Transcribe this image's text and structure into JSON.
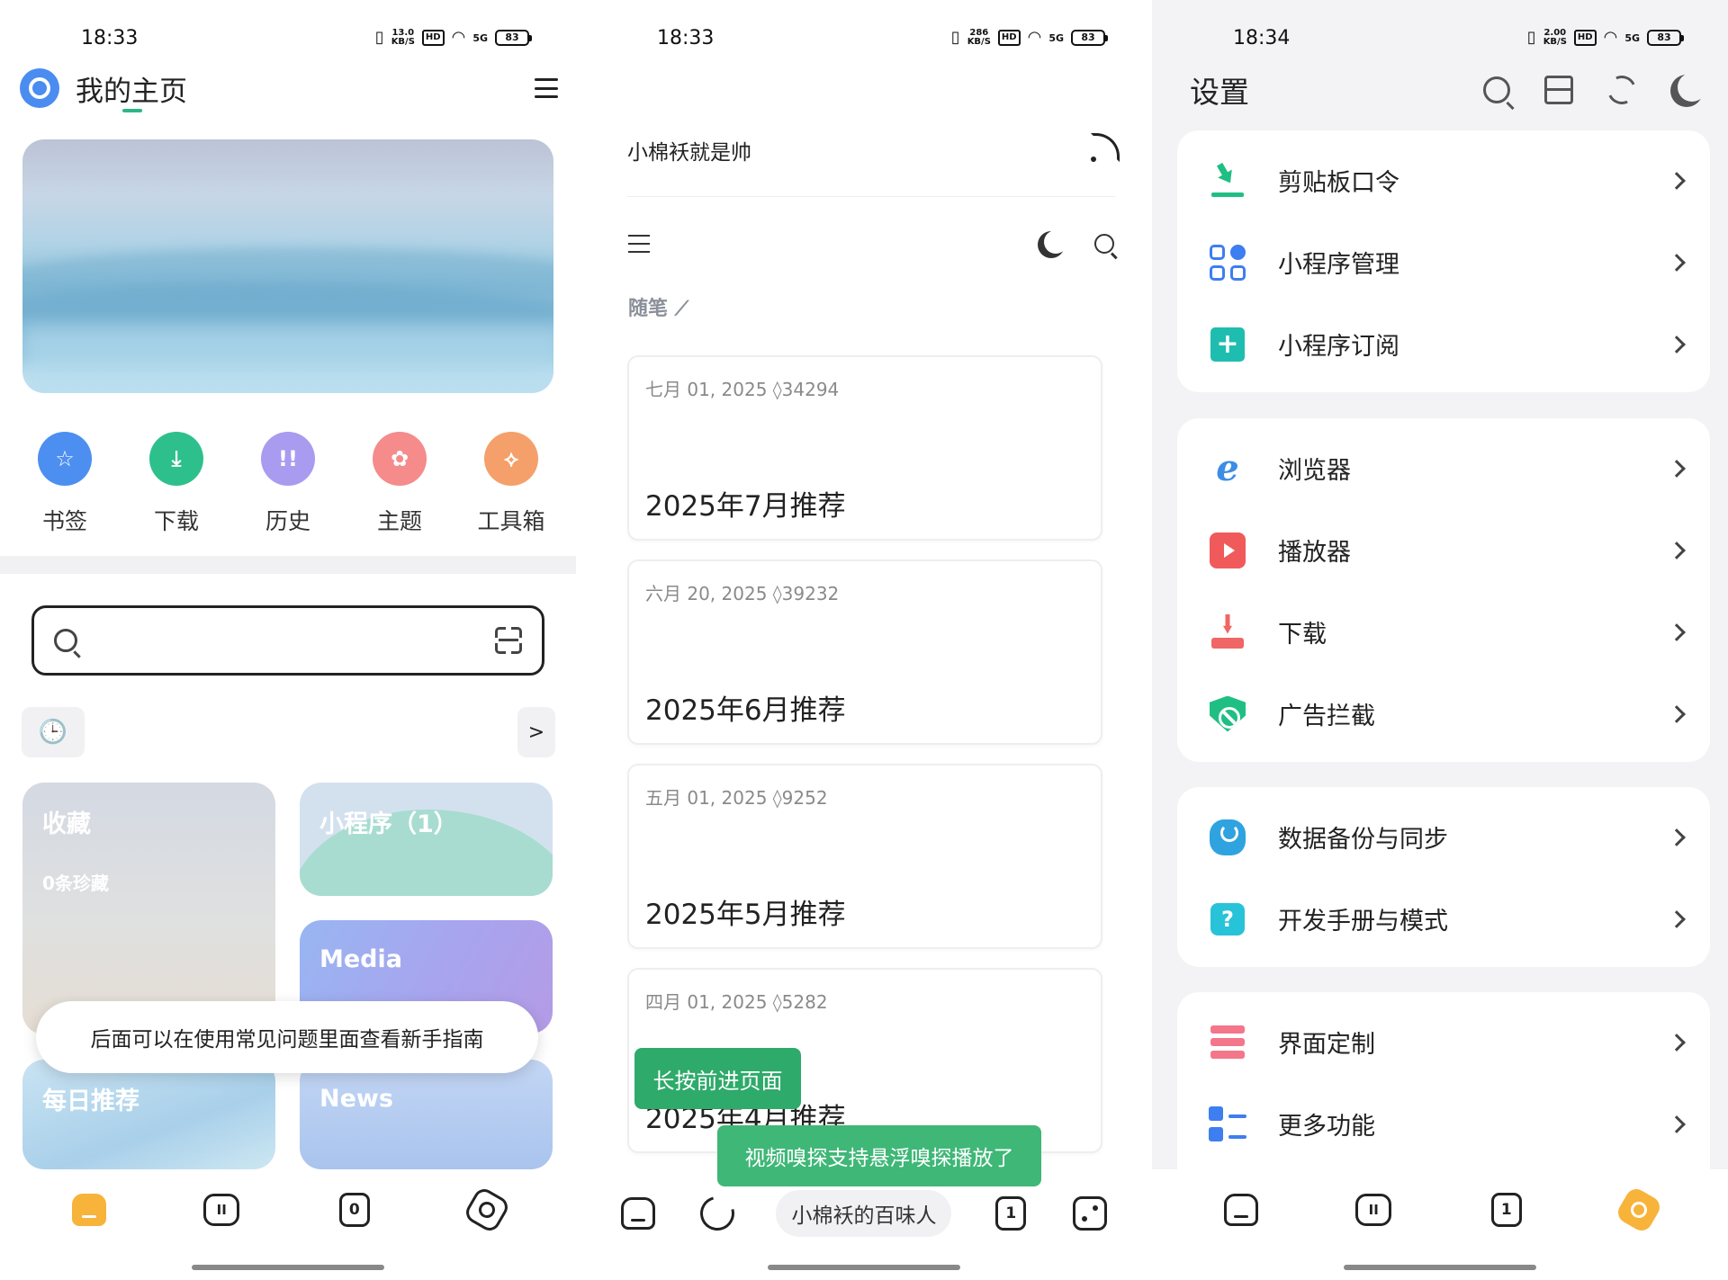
{
  "panel1": {
    "status": {
      "time": "18:33",
      "speed": "13.0\nKB/S",
      "hd": "HD",
      "signal": "5G",
      "battery": "83"
    },
    "header": {
      "title": "我的主页"
    },
    "quick": [
      {
        "label": "书签",
        "icon": "star-icon",
        "color": "#4d8ff0",
        "glyph": "☆"
      },
      {
        "label": "下载",
        "icon": "download-icon",
        "color": "#2ec08c",
        "glyph": "⤓"
      },
      {
        "label": "历史",
        "icon": "footprint-icon",
        "color": "#a99bf0",
        "glyph": "!!"
      },
      {
        "label": "主题",
        "icon": "theme-icon",
        "color": "#f58b8b",
        "glyph": "✿"
      },
      {
        "label": "工具箱",
        "icon": "toolbox-icon",
        "color": "#f5a06a",
        "glyph": "⟡"
      }
    ],
    "history_more": ">",
    "cards": {
      "favorites": {
        "title": "收藏",
        "subtitle": "0条珍藏"
      },
      "mini": {
        "title": "小程序（1）"
      },
      "media": {
        "title": "Media"
      },
      "daily": {
        "title": "每日推荐"
      },
      "news": {
        "title": "News"
      }
    },
    "toast": "后面可以在使用常见问题里面查看新手指南",
    "nav": {
      "box": "II",
      "tab": "0"
    }
  },
  "panel2": {
    "status": {
      "time": "18:33",
      "speed": "286\nKB/S",
      "hd": "HD",
      "signal": "5G",
      "battery": "83"
    },
    "site_name": "小棉袄就是帅",
    "category": "随笔",
    "posts": [
      {
        "meta": "七月 01, 2025 ◊34294",
        "title": "2025年7月推荐"
      },
      {
        "meta": "六月 20, 2025 ◊39232",
        "title": "2025年6月推荐"
      },
      {
        "meta": "五月 01, 2025 ◊9252",
        "title": "2025年5月推荐"
      },
      {
        "meta": "四月 01, 2025 ◊5282",
        "title": "2025年4月推荐"
      }
    ],
    "toast_forward": "长按前进页面",
    "toast_sniff": "视频嗅探支持悬浮嗅探播放了",
    "nav": {
      "pill": "小棉袄的百味人",
      "tab": "1"
    }
  },
  "panel3": {
    "status": {
      "time": "18:34",
      "speed": "2.00\nKB/S",
      "hd": "HD",
      "signal": "5G",
      "battery": "83"
    },
    "title": "设置",
    "groups": [
      [
        {
          "label": "剪贴板口令",
          "icon": "clipboard-command-icon"
        },
        {
          "label": "小程序管理",
          "icon": "miniapp-manage-icon"
        },
        {
          "label": "小程序订阅",
          "icon": "miniapp-subscribe-icon"
        }
      ],
      [
        {
          "label": "浏览器",
          "icon": "browser-icon"
        },
        {
          "label": "播放器",
          "icon": "player-icon"
        },
        {
          "label": "下载",
          "icon": "download-icon"
        },
        {
          "label": "广告拦截",
          "icon": "ad-block-icon"
        }
      ],
      [
        {
          "label": "数据备份与同步",
          "icon": "cloud-sync-icon"
        },
        {
          "label": "开发手册与模式",
          "icon": "help-icon"
        }
      ],
      [
        {
          "label": "界面定制",
          "icon": "ui-custom-icon"
        },
        {
          "label": "更多功能",
          "icon": "more-features-icon"
        }
      ]
    ],
    "nav": {
      "box": "II",
      "tab": "1"
    }
  }
}
